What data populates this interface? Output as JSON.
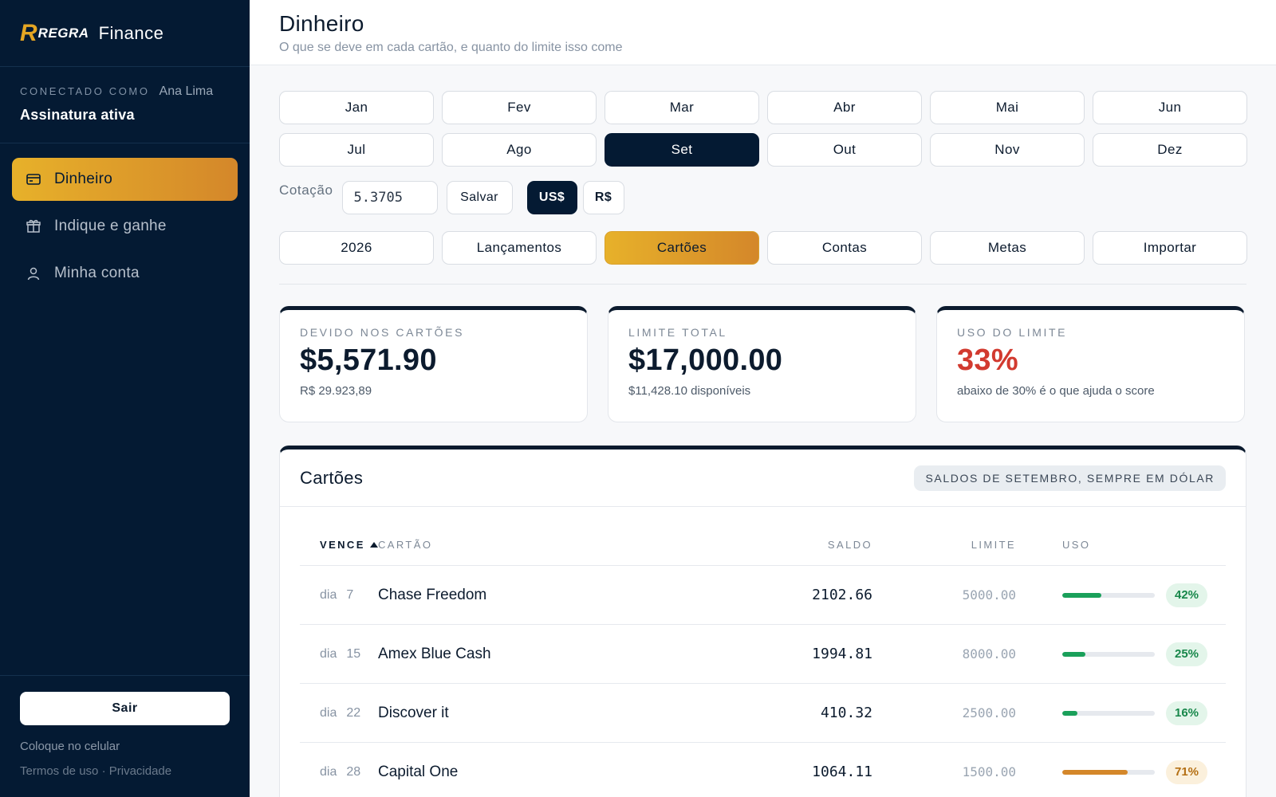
{
  "brand": {
    "mark": "R",
    "name": "REGRA",
    "product": "Finance"
  },
  "account": {
    "connected_label": "CONECTADO COMO",
    "user": "Ana Lima",
    "status": "Assinatura ativa"
  },
  "nav": [
    {
      "label": "Dinheiro",
      "icon": "credit-card-icon",
      "active": true
    },
    {
      "label": "Indique e ganhe",
      "icon": "gift-icon",
      "active": false
    },
    {
      "label": "Minha conta",
      "icon": "user-icon",
      "active": false
    }
  ],
  "footer": {
    "logout": "Sair",
    "install": "Coloque no celular",
    "terms": "Termos de uso",
    "separator": "·",
    "privacy": "Privacidade"
  },
  "header": {
    "title": "Dinheiro",
    "subtitle": "O que se deve em cada cartão, e quanto do limite isso come"
  },
  "months": [
    "Jan",
    "Fev",
    "Mar",
    "Abr",
    "Mai",
    "Jun",
    "Jul",
    "Ago",
    "Set",
    "Out",
    "Nov",
    "Dez"
  ],
  "selected_month": "Set",
  "rate": {
    "label": "Cotação",
    "value": "5.3705",
    "save": "Salvar",
    "usd": "US$",
    "brl": "R$",
    "selected_currency": "US$"
  },
  "sections": [
    "2026",
    "Lançamentos",
    "Cartões",
    "Contas",
    "Metas",
    "Importar"
  ],
  "selected_section": "Cartões",
  "stats": [
    {
      "label": "DEVIDO NOS CARTÕES",
      "value": "$5,571.90",
      "note": "R$ 29.923,89"
    },
    {
      "label": "LIMITE TOTAL",
      "value": "$17,000.00",
      "note": "$11,428.10 disponíveis"
    },
    {
      "label": "USO DO LIMITE",
      "value": "33%",
      "note": "abaixo de 30% é o que ajuda o score"
    }
  ],
  "cards_table": {
    "title": "Cartões",
    "badge": "SALDOS DE SETEMBRO, SEMPRE EM DÓLAR",
    "columns": {
      "due": "VENCE",
      "card": "CARTÃO",
      "balance": "SALDO",
      "limit": "LIMITE",
      "use": "USO"
    },
    "due_word": "dia",
    "rows": [
      {
        "due_day": "7",
        "card": "Chase Freedom",
        "balance": "2102.66",
        "limit": "5000.00",
        "use_pct": 42,
        "use_label": "42%"
      },
      {
        "due_day": "15",
        "card": "Amex Blue Cash",
        "balance": "1994.81",
        "limit": "8000.00",
        "use_pct": 25,
        "use_label": "25%"
      },
      {
        "due_day": "22",
        "card": "Discover it",
        "balance": "410.32",
        "limit": "2500.00",
        "use_pct": 16,
        "use_label": "16%"
      },
      {
        "due_day": "28",
        "card": "Capital One",
        "balance": "1064.11",
        "limit": "1500.00",
        "use_pct": 71,
        "use_label": "71%"
      }
    ]
  },
  "colors": {
    "sidebar": "#041a33",
    "accent_gold": "#e7b12a",
    "use_ok": "#1aa05a",
    "use_warn": "#d4872a",
    "alert_red": "#d23a2f"
  }
}
